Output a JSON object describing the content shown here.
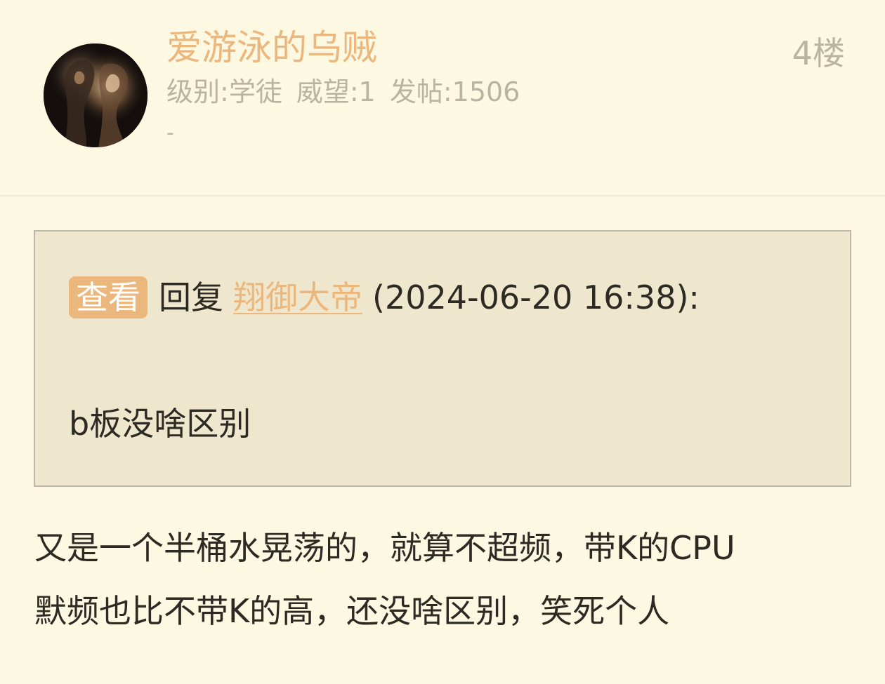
{
  "post": {
    "author": {
      "name": "爱游泳的乌贼",
      "level_label": "级别:",
      "level": "学徒",
      "prestige_label": "威望:",
      "prestige": "1",
      "posts_label": "发帖:",
      "posts": "1506",
      "signature": "-"
    },
    "floor": "4楼",
    "quote": {
      "view_label": "查看",
      "reply_label": "回复",
      "reply_user": "翔御大帝",
      "timestamp": "(2024-06-20 16:38):",
      "text": "b板没啥区别"
    },
    "body_lines": [
      "又是一个半桶水晃荡的，就算不超频，带K的CPU",
      "默频也比不带K的高，还没啥区别，笑死个人"
    ]
  },
  "colors": {
    "background": "#fdf8e2",
    "accent": "#ecb77d",
    "muted": "#b9b4a2",
    "quote_bg": "#efe7cd",
    "text": "#2d2a24"
  },
  "icons": {
    "avatar": "user-avatar-photo"
  }
}
